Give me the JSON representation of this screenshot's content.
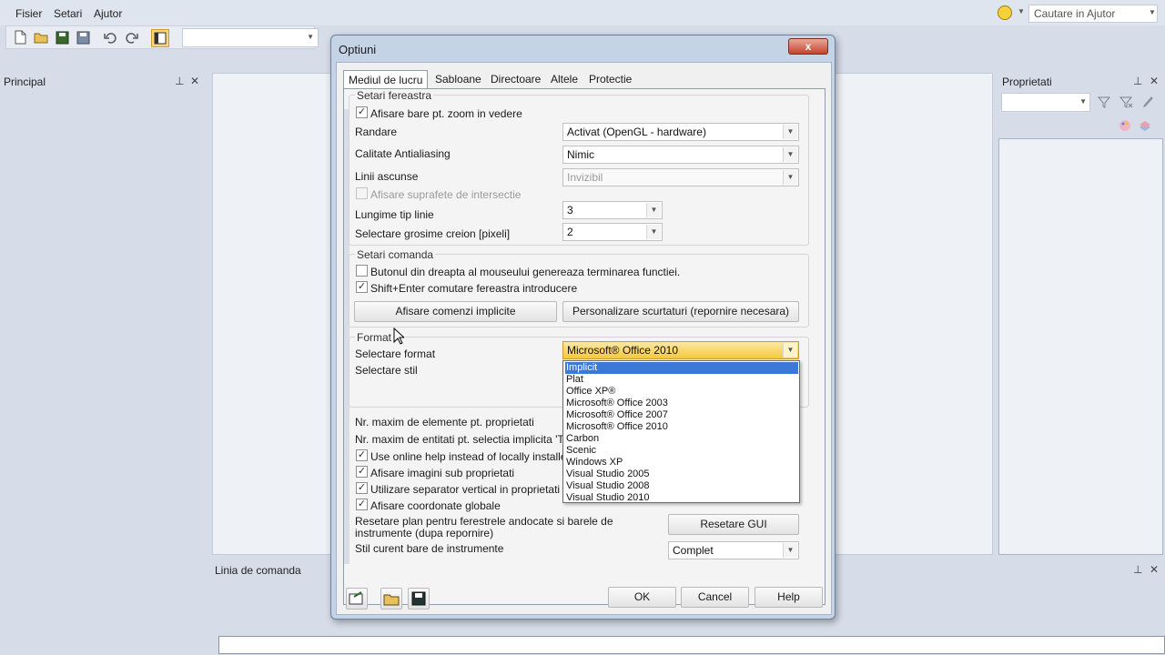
{
  "menu": [
    "Fisier",
    "Setari",
    "Ajutor"
  ],
  "search": {
    "value": "Cautare in Ajutor"
  },
  "panels": {
    "left_title": "Principal",
    "right_title": "Proprietati",
    "command_title": "Linia de comanda"
  },
  "pane_buttons": {
    "pin": "⊥",
    "close": "✕"
  },
  "dialog": {
    "title": "Optiuni",
    "close": "x",
    "tabs": [
      "Mediul de lucru",
      "Sabloane",
      "Directoare",
      "Altele",
      "Protectie"
    ],
    "window_group": {
      "title": "Setari fereastra",
      "zoom_bars": {
        "label": "Afisare bare pt. zoom in vedere",
        "checked": true
      },
      "rendering": {
        "label": "Randare",
        "value": "Activat (OpenGL - hardware)"
      },
      "antialiasing": {
        "label": "Calitate Antialiasing",
        "value": "Nimic"
      },
      "hidden_lines": {
        "label": "Linii ascunse",
        "value": "Invizibil"
      },
      "intersection": {
        "label": "Afisare suprafete de intersectie"
      },
      "line_type_length": {
        "label": "Lungime tip linie",
        "value": "3"
      },
      "pen_width": {
        "label": "Selectare grosime creion [pixeli]",
        "value": "2"
      }
    },
    "command_group": {
      "title": "Setari comanda",
      "right_button": {
        "label": "Butonul din dreapta al mouseului genereaza terminarea functiei.",
        "checked": false
      },
      "shift_enter": {
        "label": "Shift+Enter comutare fereastra introducere",
        "checked": true
      },
      "show_defaults_button": "Afisare comenzi implicite",
      "customize_shortcuts_button": "Personalizare scurtaturi (repornire necesara)"
    },
    "format_group": {
      "title": "Format",
      "select_format_label": "Selectare format",
      "select_style_label": "Selectare stil",
      "selected_format": "Microsoft® Office 2010",
      "options": [
        "Implicit",
        "Plat",
        "Office XP®",
        "Microsoft® Office 2003",
        "Microsoft® Office 2007",
        "Microsoft® Office 2010",
        "Carbon",
        "Scenic",
        "Windows XP",
        "Visual Studio 2005",
        "Visual Studio 2008",
        "Visual Studio 2010"
      ],
      "highlighted_option": "Implicit"
    },
    "misc": {
      "max_props": "Nr. maxim de elemente pt. proprietati",
      "max_entities": "Nr. maxim de entitati pt. selectia implicita 'Tot'",
      "online_help": {
        "label": "Use online help instead of locally installed he",
        "checked": true
      },
      "images_props": {
        "label": "Afisare imagini sub proprietati",
        "checked": true
      },
      "vertical_sep": {
        "label": "Utilizare separator vertical in proprietati",
        "checked": true
      },
      "global_coords": {
        "label": "Afisare coordonate globale",
        "checked": true
      },
      "reset_plan_label": "Resetare plan pentru ferestrele andocate si barele de instrumente (dupa repornire)",
      "reset_gui_button": "Resetare GUI",
      "toolbar_style_label": "Stil curent bare de instrumente",
      "toolbar_style_value": "Complet"
    },
    "buttons": {
      "ok": "OK",
      "cancel": "Cancel",
      "help": "Help"
    }
  },
  "check_glyph": "✓",
  "colors": {
    "accent_selection": "#3b78d8",
    "highlight_combo": "#f5c83c",
    "close_button": "#c5422d"
  }
}
